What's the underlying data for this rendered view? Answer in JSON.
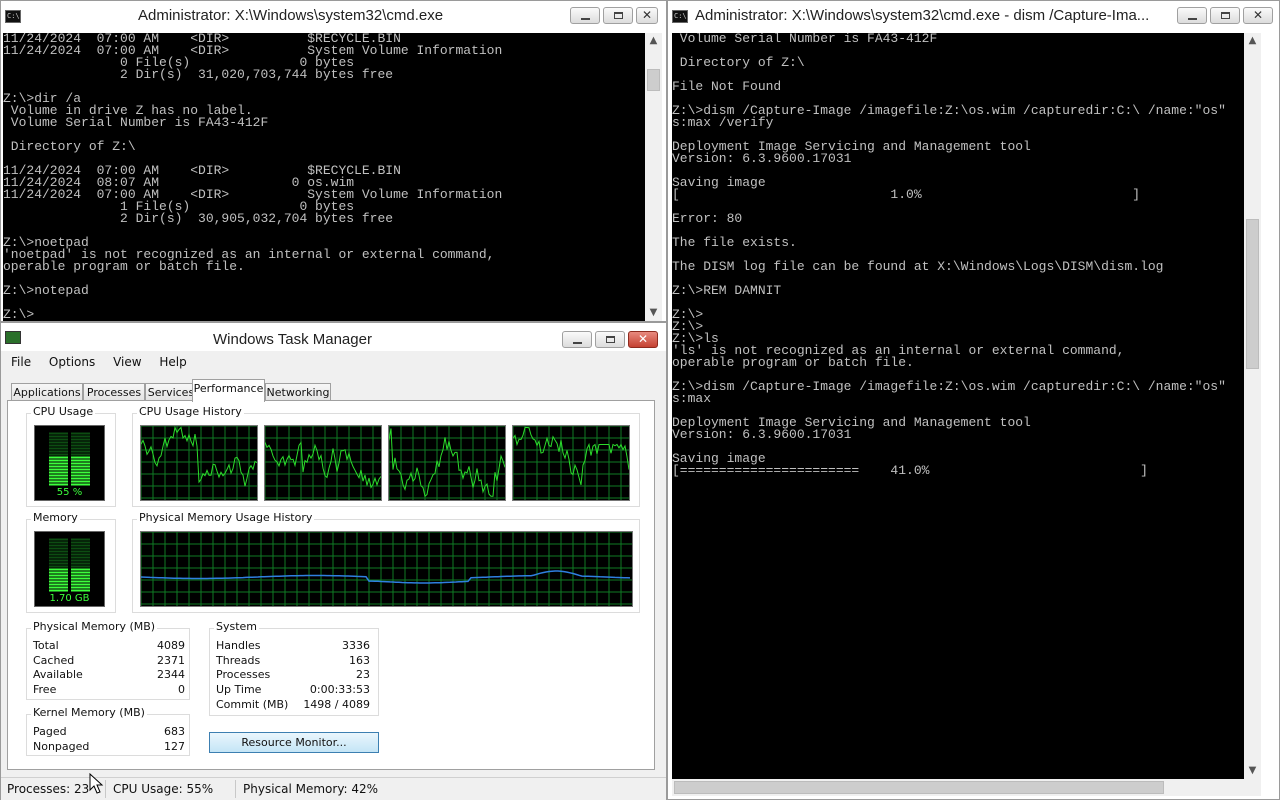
{
  "left_cmd": {
    "title": "Administrator: X:\\Windows\\system32\\cmd.exe",
    "icon": "C:\\",
    "lines": [
      "11/24/2024  07:00 AM    <DIR>          $RECYCLE.BIN",
      "11/24/2024  07:00 AM    <DIR>          System Volume Information",
      "               0 File(s)              0 bytes",
      "               2 Dir(s)  31,020,703,744 bytes free",
      "",
      "Z:\\>dir /a",
      " Volume in drive Z has no label.",
      " Volume Serial Number is FA43-412F",
      "",
      " Directory of Z:\\",
      "",
      "11/24/2024  07:00 AM    <DIR>          $RECYCLE.BIN",
      "11/24/2024  08:07 AM                 0 os.wim",
      "11/24/2024  07:00 AM    <DIR>          System Volume Information",
      "               1 File(s)              0 bytes",
      "               2 Dir(s)  30,905,032,704 bytes free",
      "",
      "Z:\\>noetpad",
      "'noetpad' is not recognized as an internal or external command,",
      "operable program or batch file.",
      "",
      "Z:\\>notepad",
      "",
      "Z:\\>"
    ]
  },
  "right_cmd": {
    "title": "Administrator: X:\\Windows\\system32\\cmd.exe - dism  /Capture-Ima...",
    "icon": "C:\\",
    "lines": [
      " Volume Serial Number is FA43-412F",
      "",
      " Directory of Z:\\",
      "",
      "File Not Found",
      "",
      "Z:\\>dism /Capture-Image /imagefile:Z:\\os.wim /capturedir:C:\\ /name:\"os\"",
      "s:max /verify",
      "",
      "Deployment Image Servicing and Management tool",
      "Version: 6.3.9600.17031",
      "",
      "Saving image",
      "[                           1.0%                           ]",
      "",
      "Error: 80",
      "",
      "The file exists.",
      "",
      "The DISM log file can be found at X:\\Windows\\Logs\\DISM\\dism.log",
      "",
      "Z:\\>REM DAMNIT",
      "",
      "Z:\\>",
      "Z:\\>",
      "Z:\\>ls",
      "'ls' is not recognized as an internal or external command,",
      "operable program or batch file.",
      "",
      "Z:\\>dism /Capture-Image /imagefile:Z:\\os.wim /capturedir:C:\\ /name:\"os\"",
      "s:max",
      "",
      "Deployment Image Servicing and Management tool",
      "Version: 6.3.9600.17031",
      "",
      "Saving image",
      "[=======================    41.0%                           ]"
    ]
  },
  "taskmgr": {
    "title": "Windows Task Manager",
    "menu": [
      "File",
      "Options",
      "View",
      "Help"
    ],
    "tabs": [
      "Applications",
      "Processes",
      "Services",
      "Performance",
      "Networking"
    ],
    "active_tab": "Performance",
    "cpu_usage_label": "CPU Usage",
    "cpu_usage_value": "55 %",
    "cpu_usage_level": 0.55,
    "cpu_history_label": "CPU Usage History",
    "memory_label": "Memory",
    "memory_value": "1.70 GB",
    "memory_level": 0.42,
    "phys_history_label": "Physical Memory Usage History",
    "physical_memory": {
      "label": "Physical Memory (MB)",
      "rows": [
        {
          "k": "Total",
          "v": "4089"
        },
        {
          "k": "Cached",
          "v": "2371"
        },
        {
          "k": "Available",
          "v": "2344"
        },
        {
          "k": "Free",
          "v": "0"
        }
      ]
    },
    "kernel_memory": {
      "label": "Kernel Memory (MB)",
      "rows": [
        {
          "k": "Paged",
          "v": "683"
        },
        {
          "k": "Nonpaged",
          "v": "127"
        }
      ]
    },
    "system": {
      "label": "System",
      "rows": [
        {
          "k": "Handles",
          "v": "3336"
        },
        {
          "k": "Threads",
          "v": "163"
        },
        {
          "k": "Processes",
          "v": "23"
        },
        {
          "k": "Up Time",
          "v": "0:00:33:53"
        },
        {
          "k": "Commit (MB)",
          "v": "1498 / 4089"
        }
      ]
    },
    "resource_monitor_label": "Resource Monitor...",
    "status": {
      "processes": "Processes: 23",
      "cpu": "CPU Usage: 55%",
      "memory": "Physical Memory: 42%"
    }
  },
  "colors": {
    "graph_green": "#2bdc2b",
    "grid_green": "#0f7a24",
    "memory_line": "#2f7fe0",
    "console_bg": "#000000",
    "console_fg": "#c0c0c0"
  }
}
